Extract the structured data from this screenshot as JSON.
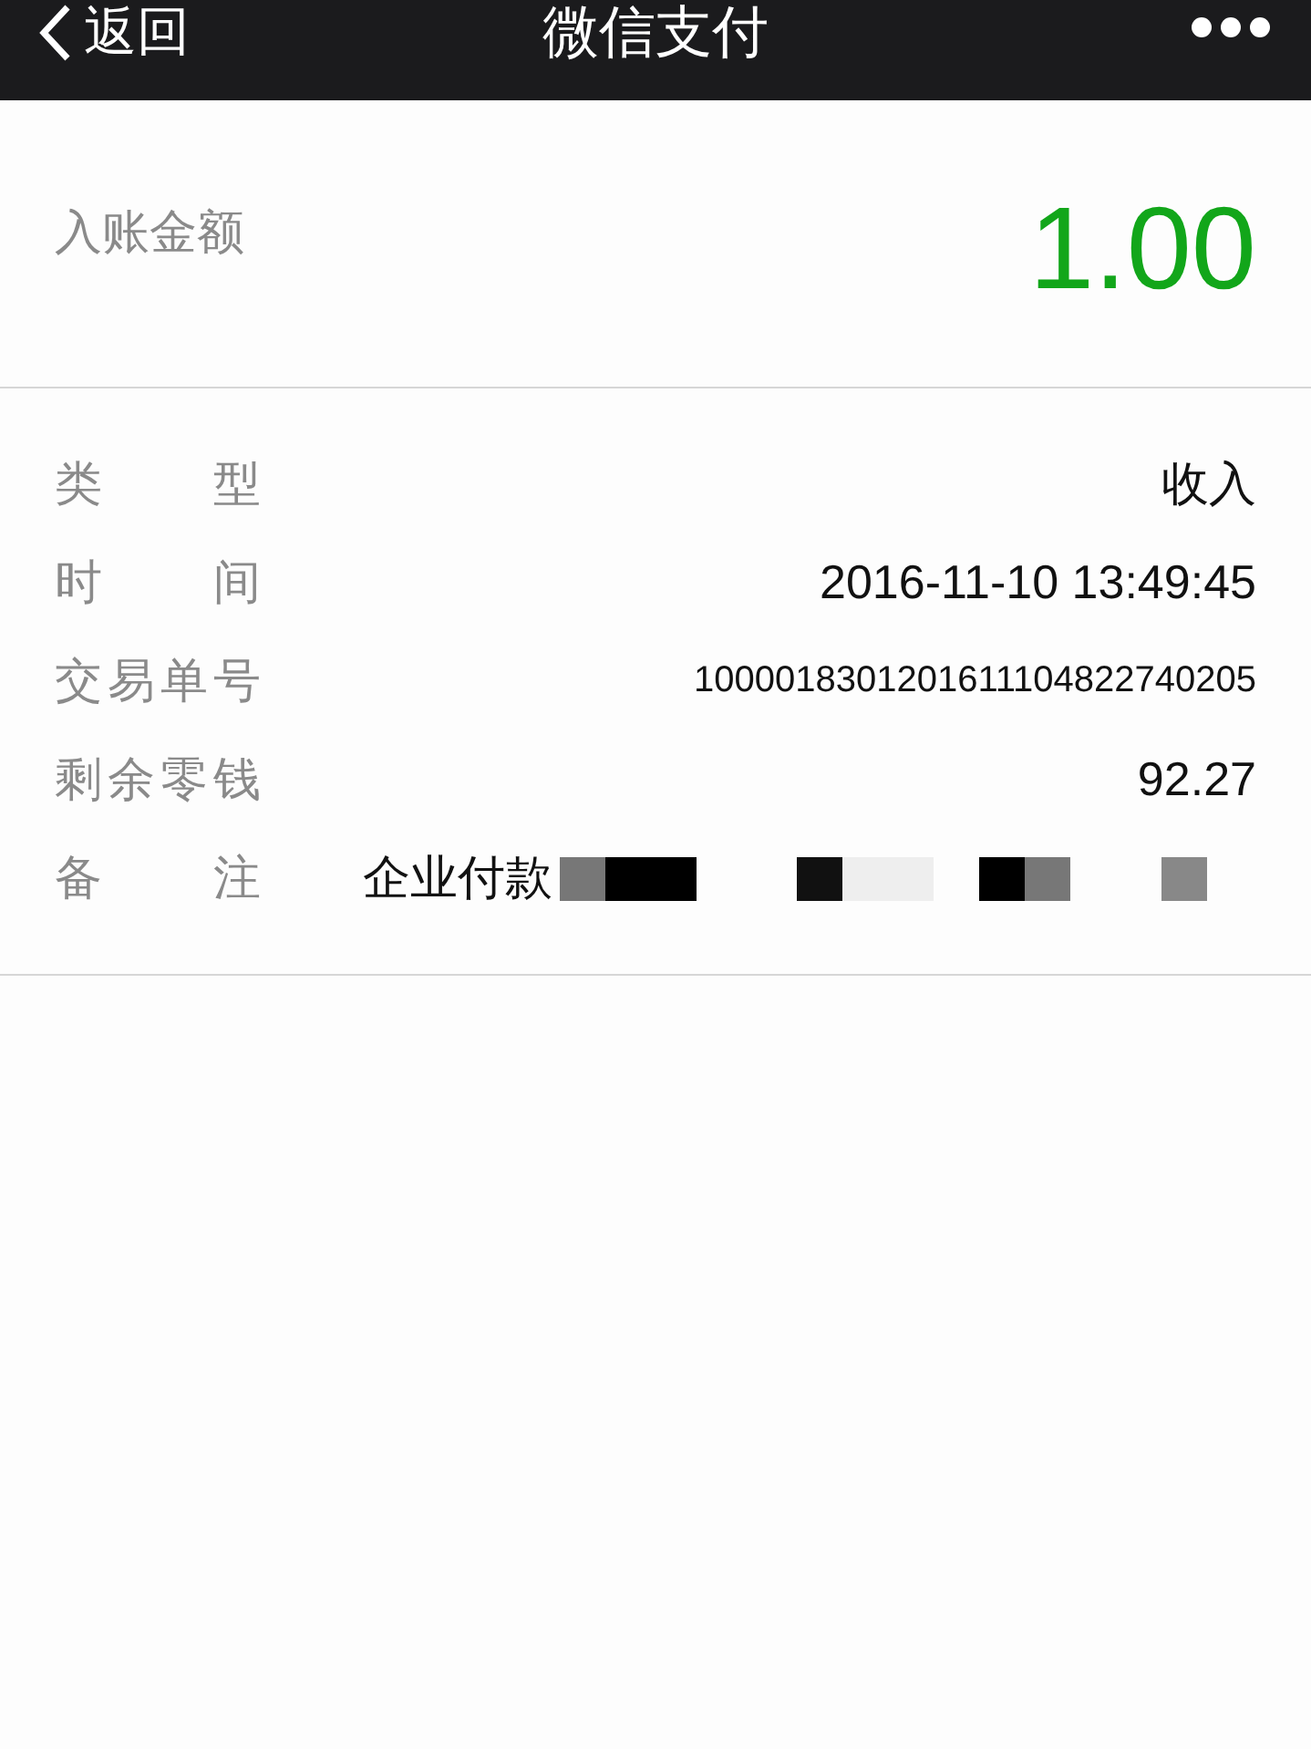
{
  "nav_bar": {
    "back_label": "返回",
    "title": "微信支付"
  },
  "amount": {
    "label": "入账金额",
    "value": "1.00"
  },
  "details": [
    {
      "label": "类型",
      "value": "收入",
      "kind": "text"
    },
    {
      "label": "时间",
      "value": "2016-11-10 13:49:45",
      "kind": "text"
    },
    {
      "label": "交易单号",
      "value": "1000018301201611104822740205",
      "kind": "small"
    },
    {
      "label": "剩余零钱",
      "value": "92.27",
      "kind": "text"
    },
    {
      "label": "备注",
      "value": "企业付款",
      "kind": "redacted"
    }
  ]
}
